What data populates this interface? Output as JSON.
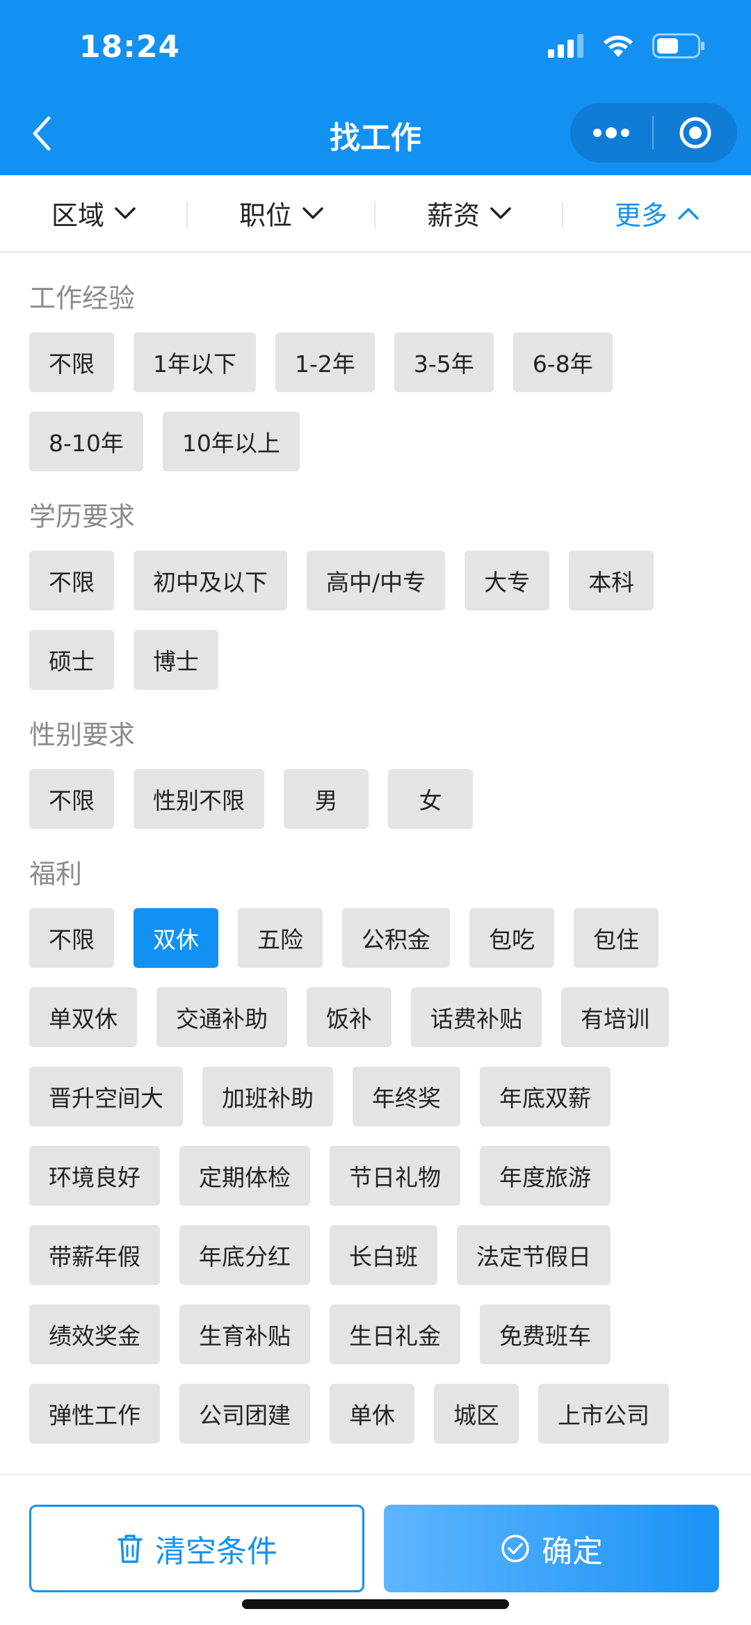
{
  "status_bar": {
    "time": "18:24"
  },
  "nav": {
    "title": "找工作"
  },
  "filter_tabs": [
    {
      "label": "区域",
      "active": false
    },
    {
      "label": "职位",
      "active": false
    },
    {
      "label": "薪资",
      "active": false
    },
    {
      "label": "更多",
      "active": true
    }
  ],
  "sections": [
    {
      "title": "工作经验",
      "tags": [
        {
          "label": "不限",
          "selected": false
        },
        {
          "label": "1年以下",
          "selected": false
        },
        {
          "label": "1-2年",
          "selected": false
        },
        {
          "label": "3-5年",
          "selected": false
        },
        {
          "label": "6-8年",
          "selected": false
        },
        {
          "label": "8-10年",
          "selected": false
        },
        {
          "label": "10年以上",
          "selected": false
        }
      ]
    },
    {
      "title": "学历要求",
      "tags": [
        {
          "label": "不限",
          "selected": false
        },
        {
          "label": "初中及以下",
          "selected": false
        },
        {
          "label": "高中/中专",
          "selected": false
        },
        {
          "label": "大专",
          "selected": false
        },
        {
          "label": "本科",
          "selected": false
        },
        {
          "label": "硕士",
          "selected": false
        },
        {
          "label": "博士",
          "selected": false
        }
      ]
    },
    {
      "title": "性别要求",
      "tags": [
        {
          "label": "不限",
          "selected": false
        },
        {
          "label": "性别不限",
          "selected": false
        },
        {
          "label": "男",
          "selected": false
        },
        {
          "label": "女",
          "selected": false
        }
      ]
    },
    {
      "title": "福利",
      "tags": [
        {
          "label": "不限",
          "selected": false
        },
        {
          "label": "双休",
          "selected": true
        },
        {
          "label": "五险",
          "selected": false
        },
        {
          "label": "公积金",
          "selected": false
        },
        {
          "label": "包吃",
          "selected": false
        },
        {
          "label": "包住",
          "selected": false
        },
        {
          "label": "单双休",
          "selected": false
        },
        {
          "label": "交通补助",
          "selected": false
        },
        {
          "label": "饭补",
          "selected": false
        },
        {
          "label": "话费补贴",
          "selected": false
        },
        {
          "label": "有培训",
          "selected": false
        },
        {
          "label": "晋升空间大",
          "selected": false
        },
        {
          "label": "加班补助",
          "selected": false
        },
        {
          "label": "年终奖",
          "selected": false
        },
        {
          "label": "年底双薪",
          "selected": false
        },
        {
          "label": "环境良好",
          "selected": false
        },
        {
          "label": "定期体检",
          "selected": false
        },
        {
          "label": "节日礼物",
          "selected": false
        },
        {
          "label": "年度旅游",
          "selected": false
        },
        {
          "label": "带薪年假",
          "selected": false
        },
        {
          "label": "年底分红",
          "selected": false
        },
        {
          "label": "长白班",
          "selected": false
        },
        {
          "label": "法定节假日",
          "selected": false
        },
        {
          "label": "绩效奖金",
          "selected": false
        },
        {
          "label": "生育补贴",
          "selected": false
        },
        {
          "label": "生日礼金",
          "selected": false
        },
        {
          "label": "免费班车",
          "selected": false
        },
        {
          "label": "弹性工作",
          "selected": false
        },
        {
          "label": "公司团建",
          "selected": false
        },
        {
          "label": "单休",
          "selected": false
        },
        {
          "label": "城区",
          "selected": false
        },
        {
          "label": "上市公司",
          "selected": false
        }
      ]
    }
  ],
  "bottom": {
    "clear_label": "清空条件",
    "clear_icon": "trash-icon",
    "confirm_label": "确定",
    "confirm_icon": "check-circle-icon"
  },
  "colors": {
    "primary": "#1391f2",
    "tag_bg": "#e4e4e4",
    "section_title": "#8a8a8a"
  }
}
